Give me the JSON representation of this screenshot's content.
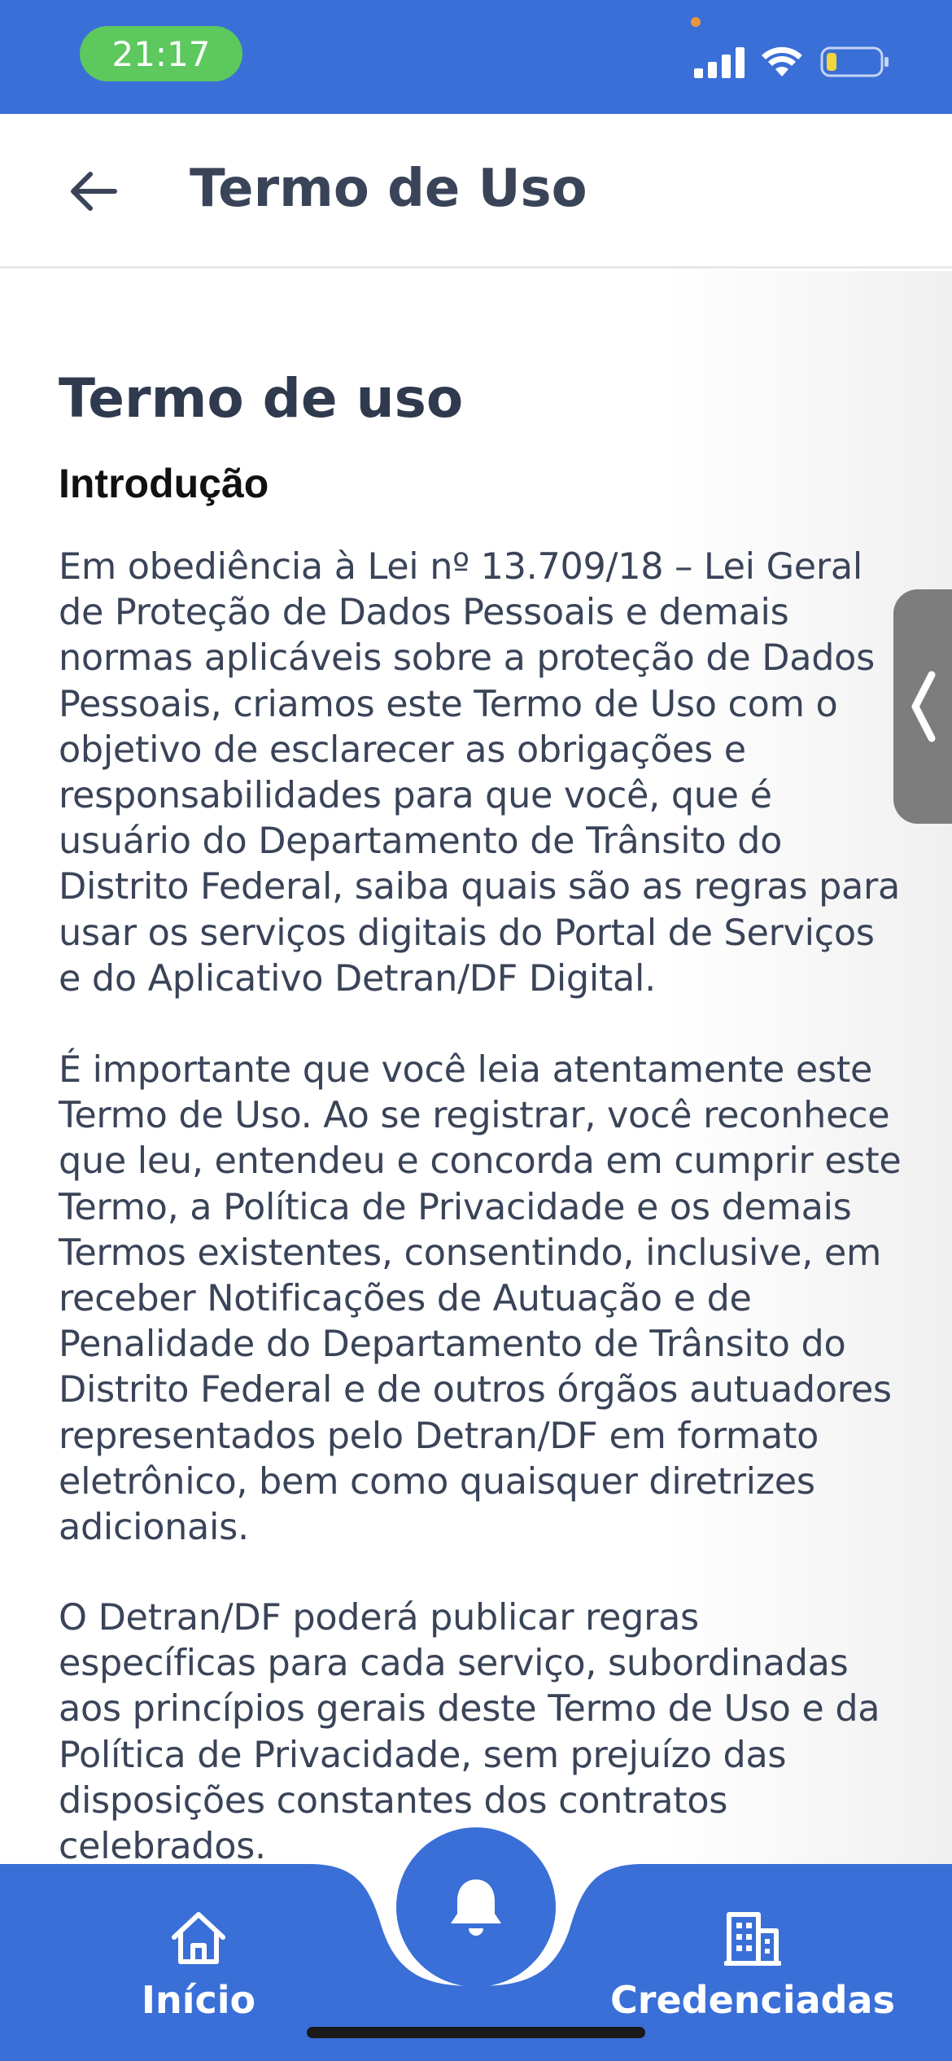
{
  "status_bar": {
    "time": "21:17"
  },
  "app_bar": {
    "title": "Termo de Uso"
  },
  "document": {
    "title": "Termo de uso",
    "section_title": "Introdução",
    "paragraphs": [
      "Em obediência à Lei nº 13.709/18 – Lei Geral de Proteção de Dados Pessoais e demais normas aplicáveis sobre a proteção de Dados Pessoais, criamos este Termo de Uso com o objetivo de esclarecer as obrigações e responsabilidades para que você, que é usuário do Departamento de Trânsito do Distrito Federal, saiba quais são as regras para usar os serviços digitais do Portal de Serviços e do Aplicativo Detran/DF Digital.",
      "É importante que você leia atentamente este Termo de Uso. Ao se registrar, você reconhece que leu, entendeu e concorda em cumprir este Termo, a Política de Privacidade e os demais Termos existentes, consentindo, inclusive, em receber Notificações de Autuação e de Penalidade do Departamento de Trânsito do Distrito Federal e de outros órgãos autuadores representados pelo Detran/DF em formato eletrônico, bem como quaisquer diretrizes adicionais.",
      "O Detran/DF poderá publicar regras específicas para cada serviço, subordinadas aos princípios gerais deste Termo de Uso e da Política de Privacidade, sem prejuízo das disposições constantes dos contratos celebrados."
    ]
  },
  "bottom_nav": {
    "home_label": "Início",
    "credenciadas_label": "Credenciadas"
  },
  "colors": {
    "primary": "#3a6fd8",
    "time_pill": "#5cc85e",
    "text": "#3a4458"
  },
  "icons": [
    "back-arrow-icon",
    "signal-icon",
    "wifi-icon",
    "battery-icon",
    "chevron-left-icon",
    "home-icon",
    "bell-icon",
    "building-icon"
  ]
}
